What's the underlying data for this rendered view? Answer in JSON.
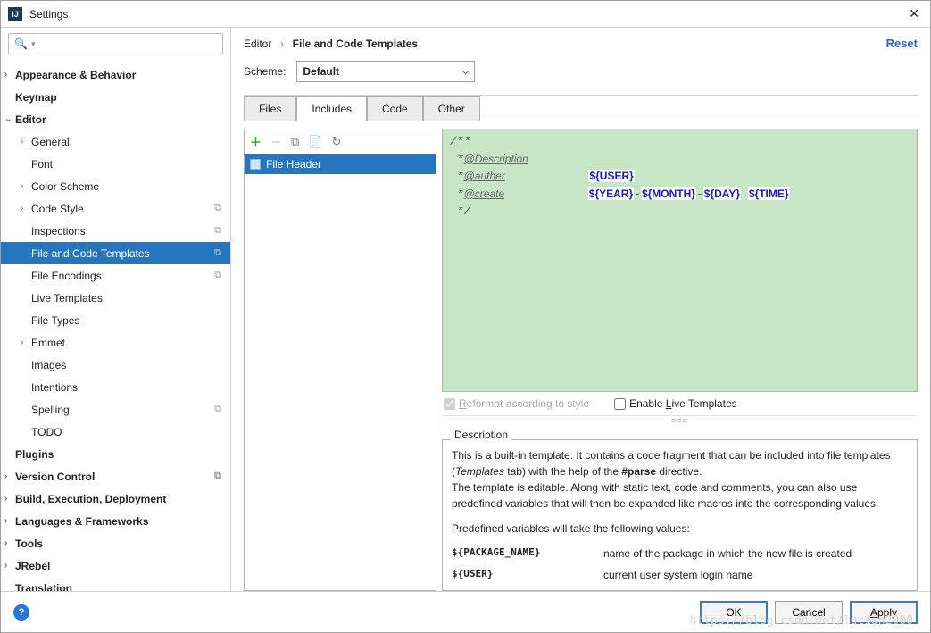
{
  "window": {
    "title": "Settings"
  },
  "search": {
    "placeholder": ""
  },
  "tree": [
    {
      "label": "Appearance & Behavior",
      "lvl": 0,
      "arrow": true,
      "bold": true
    },
    {
      "label": "Keymap",
      "lvl": 0,
      "bold": true
    },
    {
      "label": "Editor",
      "lvl": 0,
      "arrow": true,
      "open": true,
      "bold": true
    },
    {
      "label": "General",
      "lvl": 1,
      "arrow": true
    },
    {
      "label": "Font",
      "lvl": 1
    },
    {
      "label": "Color Scheme",
      "lvl": 1,
      "arrow": true
    },
    {
      "label": "Code Style",
      "lvl": 1,
      "arrow": true,
      "copy": true
    },
    {
      "label": "Inspections",
      "lvl": 1,
      "copy": true
    },
    {
      "label": "File and Code Templates",
      "lvl": 1,
      "selected": true,
      "copy": true
    },
    {
      "label": "File Encodings",
      "lvl": 1,
      "copy": true
    },
    {
      "label": "Live Templates",
      "lvl": 1
    },
    {
      "label": "File Types",
      "lvl": 1
    },
    {
      "label": "Emmet",
      "lvl": 1,
      "arrow": true
    },
    {
      "label": "Images",
      "lvl": 1
    },
    {
      "label": "Intentions",
      "lvl": 1
    },
    {
      "label": "Spelling",
      "lvl": 1,
      "copy": true
    },
    {
      "label": "TODO",
      "lvl": 1
    },
    {
      "label": "Plugins",
      "lvl": 0,
      "bold": true
    },
    {
      "label": "Version Control",
      "lvl": 0,
      "arrow": true,
      "bold": true,
      "copy": true
    },
    {
      "label": "Build, Execution, Deployment",
      "lvl": 0,
      "arrow": true,
      "bold": true
    },
    {
      "label": "Languages & Frameworks",
      "lvl": 0,
      "arrow": true,
      "bold": true
    },
    {
      "label": "Tools",
      "lvl": 0,
      "arrow": true,
      "bold": true
    },
    {
      "label": "JRebel",
      "lvl": 0,
      "arrow": true,
      "bold": true
    },
    {
      "label": "Translation",
      "lvl": 0,
      "bold": true
    }
  ],
  "breadcrumb": {
    "root": "Editor",
    "current": "File and Code Templates"
  },
  "reset": "Reset",
  "scheme": {
    "label": "Scheme:",
    "value": "Default"
  },
  "tabs": [
    "Files",
    "Includes",
    "Code",
    "Other"
  ],
  "active_tab": 1,
  "template_list": [
    {
      "name": "File Header"
    }
  ],
  "code_lines": [
    "/**",
    " *@Description",
    " *@auther            ${USER}",
    " *@create            ${YEAR}-${MONTH}-${DAY} ${TIME}",
    " */"
  ],
  "checks": {
    "reformat": "Reformat according to style",
    "live": "Enable Live Templates"
  },
  "description": {
    "legend": "Description",
    "body1": "This is a built-in template. It contains a code fragment that can be included into file templates (",
    "body1_em": "Templates",
    "body1_b": " tab) with the help of the ",
    "body1_parse": "#parse",
    "body1_end": " directive.",
    "body2": "The template is editable. Along with static text, code and comments, you can also use predefined variables that will then be expanded like macros into the corresponding values.",
    "body3": "Predefined variables will take the following values:",
    "vars": [
      {
        "k": "${PACKAGE_NAME}",
        "v": "name of the package in which the new file is created"
      },
      {
        "k": "${USER}",
        "v": "current user system login name"
      }
    ]
  },
  "buttons": {
    "ok": "OK",
    "cancel": "Cancel",
    "apply": "Apply"
  }
}
